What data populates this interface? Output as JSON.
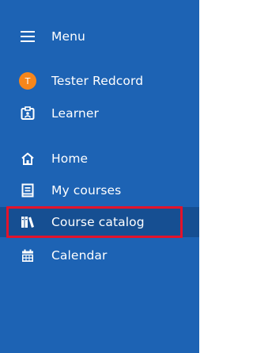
{
  "sidebar": {
    "menu_label": "Menu",
    "user": {
      "initial": "T",
      "name": "Tester Redcord"
    },
    "role": "Learner",
    "nav": [
      {
        "label": "Home",
        "icon": "home-icon"
      },
      {
        "label": "My courses",
        "icon": "book-icon"
      },
      {
        "label": "Course catalog",
        "icon": "library-icon",
        "selected": true
      },
      {
        "label": "Calendar",
        "icon": "calendar-icon"
      }
    ]
  },
  "colors": {
    "sidebar_bg": "#1d63b4",
    "selected_bg": "#164f92",
    "avatar": "#f7861b",
    "highlight_border": "#e3132b"
  }
}
